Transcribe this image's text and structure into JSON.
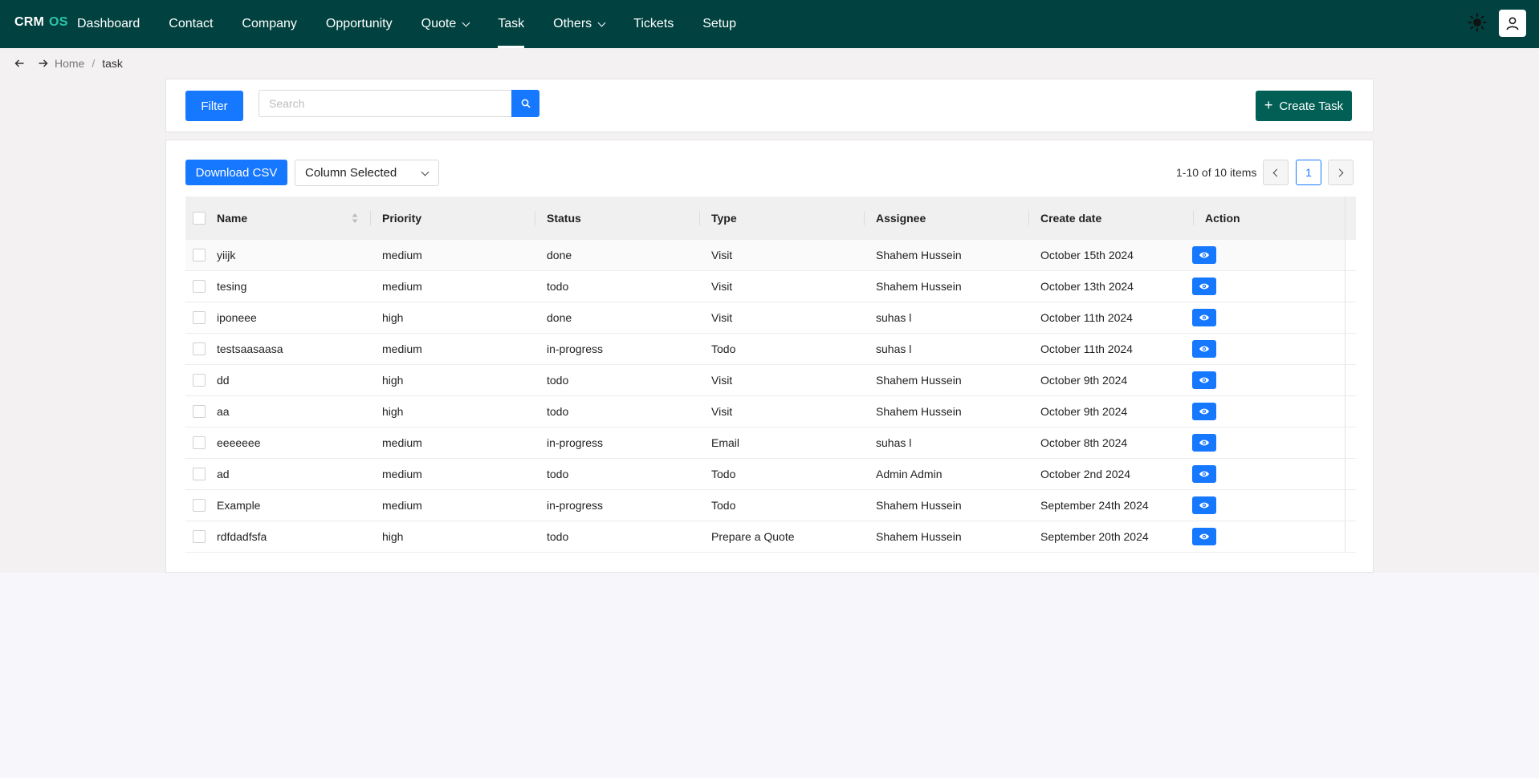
{
  "app": {
    "logo_main": "CRM",
    "logo_accent": "OS"
  },
  "nav": {
    "items": [
      {
        "label": "Dashboard",
        "dropdown": false,
        "active": false
      },
      {
        "label": "Contact",
        "dropdown": false,
        "active": false
      },
      {
        "label": "Company",
        "dropdown": false,
        "active": false
      },
      {
        "label": "Opportunity",
        "dropdown": false,
        "active": false
      },
      {
        "label": "Quote",
        "dropdown": true,
        "active": false
      },
      {
        "label": "Task",
        "dropdown": false,
        "active": true
      },
      {
        "label": "Others",
        "dropdown": true,
        "active": false
      },
      {
        "label": "Tickets",
        "dropdown": false,
        "active": false
      },
      {
        "label": "Setup",
        "dropdown": false,
        "active": false
      }
    ]
  },
  "breadcrumb": {
    "home": "Home",
    "separator": "/",
    "current": "task"
  },
  "toolbar": {
    "filter_label": "Filter",
    "search_placeholder": "Search",
    "search_value": "",
    "create_label": "Create Task"
  },
  "table_tools": {
    "csv_label": "Download CSV",
    "column_select": "Column Selected",
    "pager_text": "1-10 of 10 items",
    "current_page": "1"
  },
  "table": {
    "columns": [
      "Name",
      "Priority",
      "Status",
      "Type",
      "Assignee",
      "Create date",
      "Action"
    ],
    "rows": [
      {
        "name": "yiijk",
        "priority": "medium",
        "status": "done",
        "type": "Visit",
        "assignee": "Shahem Hussein",
        "date": "October 15th 2024"
      },
      {
        "name": "tesing",
        "priority": "medium",
        "status": "todo",
        "type": "Visit",
        "assignee": "Shahem Hussein",
        "date": "October 13th 2024"
      },
      {
        "name": "iponeee",
        "priority": "high",
        "status": "done",
        "type": "Visit",
        "assignee": "suhas l",
        "date": "October 11th 2024"
      },
      {
        "name": "testsaasaasa",
        "priority": "medium",
        "status": "in-progress",
        "type": "Todo",
        "assignee": "suhas l",
        "date": "October 11th 2024"
      },
      {
        "name": "dd",
        "priority": "high",
        "status": "todo",
        "type": "Visit",
        "assignee": "Shahem Hussein",
        "date": "October 9th 2024"
      },
      {
        "name": "aa",
        "priority": "high",
        "status": "todo",
        "type": "Visit",
        "assignee": "Shahem Hussein",
        "date": "October 9th 2024"
      },
      {
        "name": "eeeeeee",
        "priority": "medium",
        "status": "in-progress",
        "type": "Email",
        "assignee": "suhas l",
        "date": "October 8th 2024"
      },
      {
        "name": "ad",
        "priority": "medium",
        "status": "todo",
        "type": "Todo",
        "assignee": "Admin Admin",
        "date": "October 2nd 2024"
      },
      {
        "name": "Example",
        "priority": "medium",
        "status": "in-progress",
        "type": "Todo",
        "assignee": "Shahem Hussein",
        "date": "September 24th 2024"
      },
      {
        "name": "rdfdadfsfa",
        "priority": "high",
        "status": "todo",
        "type": "Prepare a Quote",
        "assignee": "Shahem Hussein",
        "date": "September 20th 2024"
      }
    ]
  },
  "icons": {
    "theme": "sun-icon",
    "user": "user-icon",
    "search": "search-icon",
    "view": "eye-icon"
  },
  "colors": {
    "nav_bg": "#014240",
    "primary": "#1677ff",
    "create_btn": "#015f55",
    "logo_accent": "#2cc7a8"
  }
}
